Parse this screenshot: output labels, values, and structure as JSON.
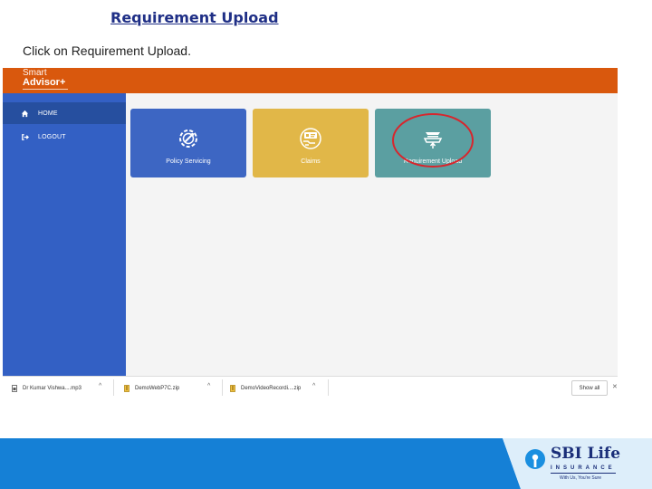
{
  "slide": {
    "title": "Requirement Upload",
    "instruction_prefix": "Click on ",
    "instruction_target": "Requirement Upload",
    "instruction_suffix": "."
  },
  "app": {
    "logo_line1": "Smart",
    "logo_line2": "Advisor+",
    "header_color": "#d9580d",
    "sidebar_color": "#3360c4"
  },
  "sidebar": {
    "items": [
      {
        "label": "HOME",
        "icon": "home-icon",
        "active": true
      },
      {
        "label": "LOGOUT",
        "icon": "logout-icon",
        "active": false
      }
    ]
  },
  "tiles": [
    {
      "label": "Policy Servicing",
      "icon": "gear-wrench-icon",
      "color": "#3d66c3"
    },
    {
      "label": "Claims",
      "icon": "claims-card-icon",
      "color": "#e1b748"
    },
    {
      "label": "Requirement Upload",
      "icon": "upload-tray-icon",
      "color": "#5b9fa1",
      "highlighted": true
    }
  ],
  "downloads": {
    "items": [
      {
        "name": "Dr Kumar Vishwa....mp3"
      },
      {
        "name": "DemoWebP7C.zip"
      },
      {
        "name": "DemoVideoRecordi....zip"
      }
    ],
    "show_all": "Show all",
    "close": "✕"
  },
  "footer": {
    "brand_name": "SBI Life",
    "brand_sub": "INSURANCE",
    "brand_tag": "With Us, You're Sure",
    "brand_color": "#1a2e79"
  }
}
